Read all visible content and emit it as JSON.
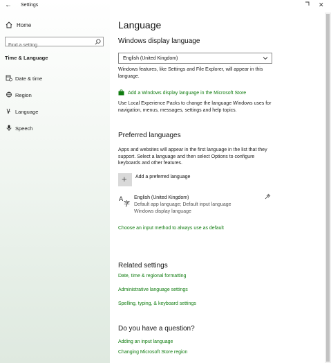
{
  "window": {
    "app_title": "Settings",
    "back_glyph": "←",
    "minimize_glyph": "—",
    "close_glyph": "✕"
  },
  "sidebar": {
    "home_label": "Home",
    "search_placeholder": "Find a setting",
    "section_title": "Time & Language",
    "items": [
      {
        "label": "Date & time",
        "icon": "calendar-clock-icon"
      },
      {
        "label": "Region",
        "icon": "globe-icon"
      },
      {
        "label": "Language",
        "icon": "language-icon",
        "active": true
      },
      {
        "label": "Speech",
        "icon": "microphone-icon"
      }
    ]
  },
  "main": {
    "title": "Language",
    "display_language": {
      "heading": "Windows display language",
      "selected": "English (United Kingdom)",
      "description": "Windows features, like Settings and File Explorer, will appear in this language.",
      "store_link": "Add a Windows display language in the Microsoft Store",
      "lxp_text": "Use Local Experience Packs to change the language Windows uses for navigation, menus, messages, settings and help topics."
    },
    "preferred": {
      "heading": "Preferred languages",
      "description": "Apps and websites will appear in the first language in the list that they support. Select a language and then select Options to configure keyboards and other features.",
      "add_label": "Add a preferred language",
      "language_name": "English (United Kingdom)",
      "language_sub1": "Default app language; Default input language",
      "language_sub2": "Windows display language",
      "input_method_link": "Choose an input method to always use as default"
    },
    "related": {
      "heading": "Related settings",
      "links": [
        "Date, time & regional formatting",
        "Administrative language settings",
        "Spelling, typing, & keyboard settings"
      ]
    },
    "question": {
      "heading": "Do you have a question?",
      "links": [
        "Adding an input language",
        "Changing Microsoft Store region"
      ]
    }
  },
  "colors": {
    "accent": "#107c10",
    "sidebar_bg": "#eef4ef",
    "scroll_thumb": "#c2c2c2"
  }
}
